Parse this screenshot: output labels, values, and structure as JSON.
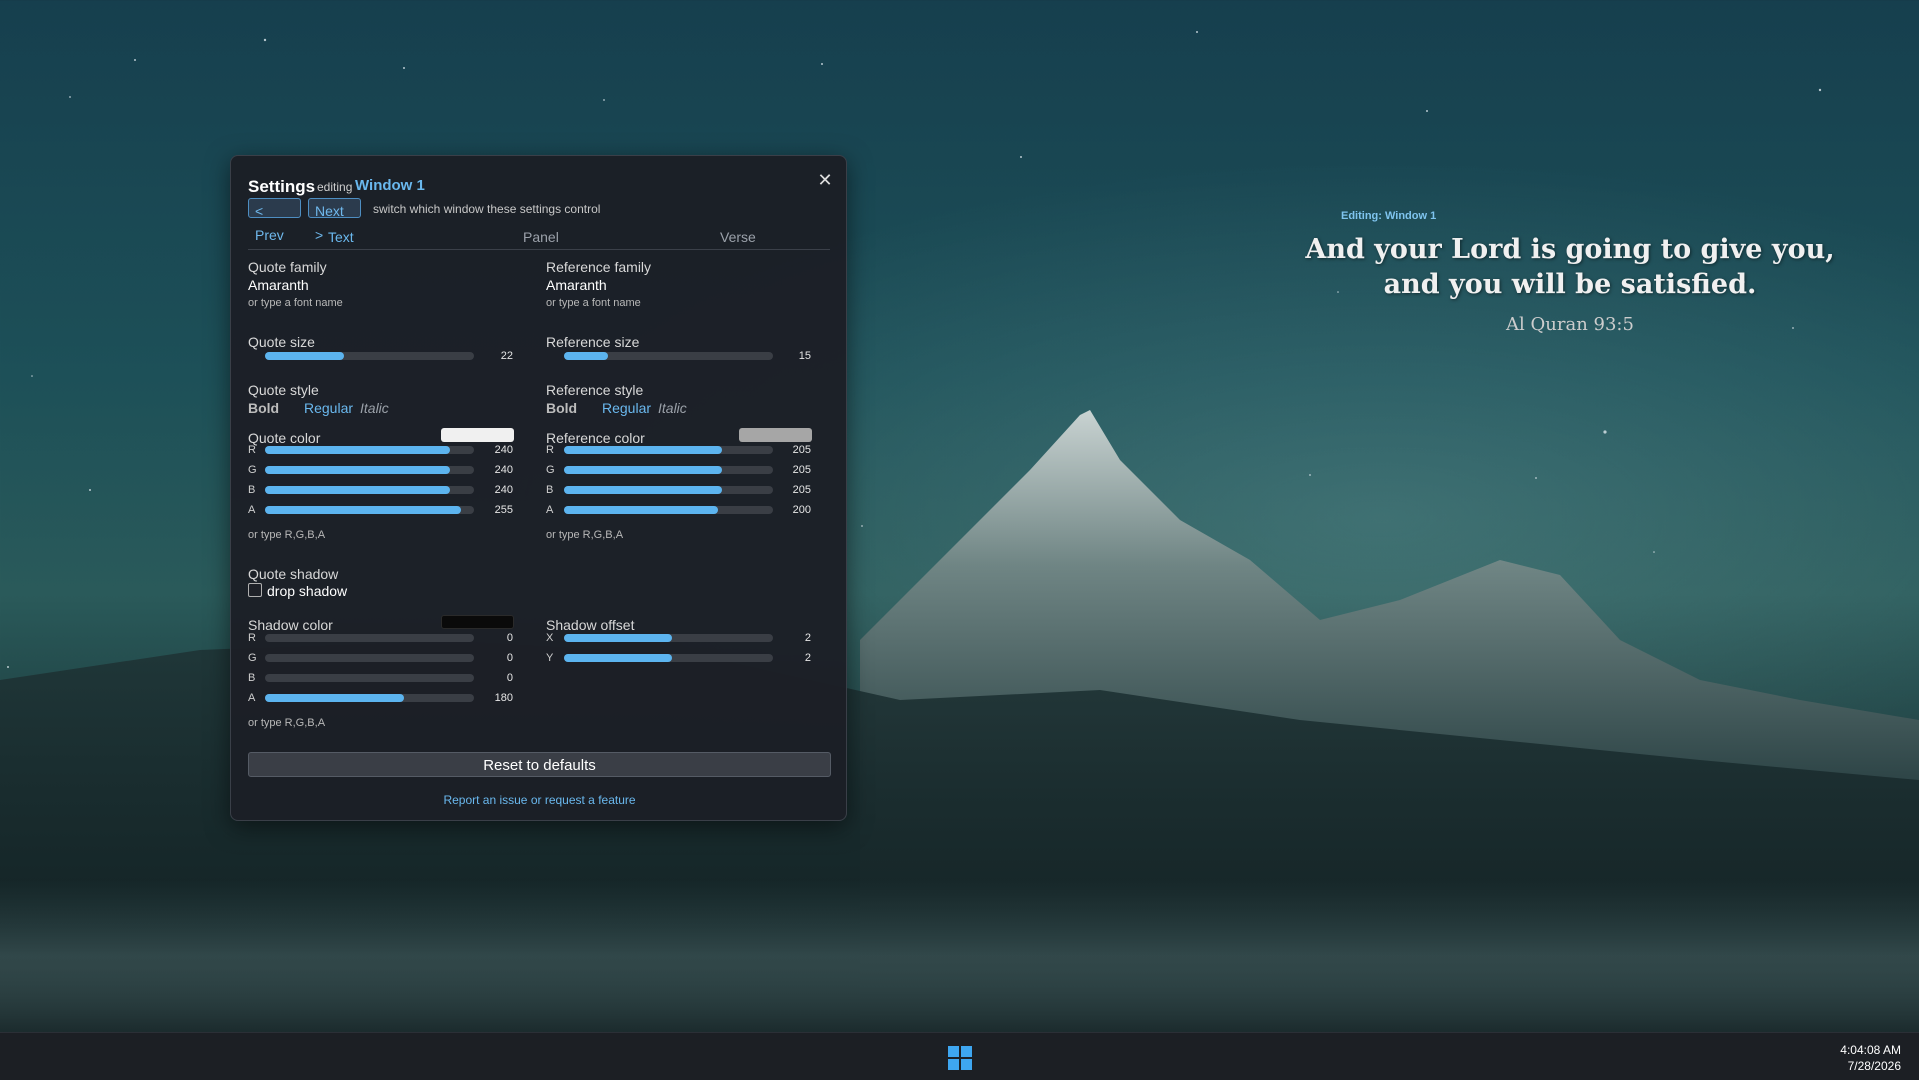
{
  "overlay": {
    "editing_tag": "Editing: Window 1",
    "quote_line1": "And your Lord is going to give you,",
    "quote_line2": "and you will be satisfied.",
    "reference": "Al Quran 93:5"
  },
  "settings": {
    "title": "Settings",
    "editing_label": "editing",
    "window_name": "Window 1",
    "close_icon": "close-icon",
    "prev_label": "< Prev",
    "next_label": "Next >",
    "nav_hint": "switch which window these settings control",
    "tabs": [
      "Text",
      "Panel",
      "Verse"
    ],
    "active_tab": "Text",
    "quote": {
      "family_label": "Quote family",
      "family_value": "Amaranth",
      "family_hint": "or type a font name",
      "size_label": "Quote size",
      "size_value": 22,
      "size_fill": 0.38,
      "style_label": "Quote style",
      "style_bold": "Bold",
      "style_regular": "Regular",
      "style_italic": "Italic",
      "color_label": "Quote color",
      "color_swatch": "#f0f0f0",
      "channels": [
        {
          "ch": "R",
          "value": 240,
          "max": 255
        },
        {
          "ch": "G",
          "value": 240,
          "max": 255
        },
        {
          "ch": "B",
          "value": 240,
          "max": 255
        },
        {
          "ch": "A",
          "value": 255,
          "max": 255
        }
      ],
      "color_hint": "or type R,G,B,A",
      "shadow_label": "Quote shadow",
      "shadow_checkbox": "drop shadow",
      "shadow_checked": false,
      "shadow_color_label": "Shadow color",
      "shadow_swatch": "#0a0a0a",
      "shadow_channels": [
        {
          "ch": "R",
          "value": 0,
          "max": 255
        },
        {
          "ch": "G",
          "value": 0,
          "max": 255
        },
        {
          "ch": "B",
          "value": 0,
          "max": 255
        },
        {
          "ch": "A",
          "value": 180,
          "max": 255
        }
      ],
      "shadow_hint": "or type R,G,B,A"
    },
    "reference": {
      "family_label": "Reference family",
      "family_value": "Amaranth",
      "family_hint": "or type a font name",
      "size_label": "Reference size",
      "size_value": 15,
      "size_fill": 0.21,
      "style_label": "Reference style",
      "style_bold": "Bold",
      "style_regular": "Regular",
      "style_italic": "Italic",
      "color_label": "Reference color",
      "color_swatch": "#a6a6a6",
      "channels": [
        {
          "ch": "R",
          "value": 205,
          "max": 255
        },
        {
          "ch": "G",
          "value": 205,
          "max": 255
        },
        {
          "ch": "B",
          "value": 205,
          "max": 255
        },
        {
          "ch": "A",
          "value": 200,
          "max": 255
        }
      ],
      "color_hint": "or type R,G,B,A",
      "offset_label": "Shadow offset",
      "offset_channels": [
        {
          "ch": "X",
          "value": 2,
          "fill": 0.55
        },
        {
          "ch": "Y",
          "value": 2,
          "fill": 0.55
        }
      ]
    },
    "reset_label": "Reset to defaults",
    "report_label": "Report an issue or request a feature"
  },
  "taskbar": {
    "start_icon": "windows-start-icon",
    "time": "4:04:08 AM",
    "date": "7/28/2026"
  },
  "colors": {
    "accent": "#5cb4ef",
    "panel_bg": "#1c1f26"
  }
}
